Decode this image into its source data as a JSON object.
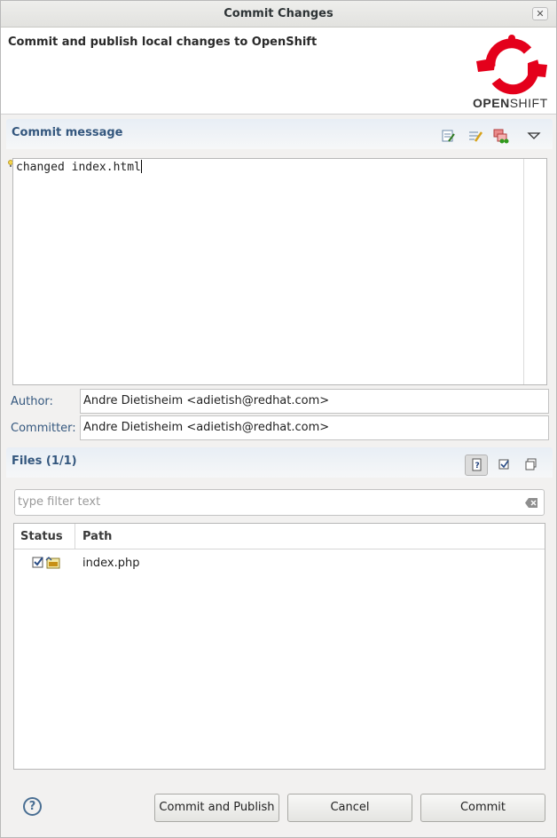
{
  "window": {
    "title": "Commit Changes",
    "close_icon": "close-icon"
  },
  "banner": {
    "description": "Commit and publish local changes to OpenShift",
    "logo_text_bold": "OPEN",
    "logo_text_rest": "SHIFT",
    "logo_color": "#e4001b"
  },
  "commit_section": {
    "title": "Commit message",
    "toolbar_icons": [
      "add-signed-off-by-icon",
      "amend-icon",
      "push-icon",
      "view-menu-chevron-icon"
    ],
    "message": "changed index.html"
  },
  "author": {
    "label": "Author:",
    "value": "Andre Dietisheim <adietish@redhat.com>"
  },
  "committer": {
    "label": "Committer:",
    "value": "Andre Dietisheim <adietish@redhat.com>"
  },
  "files_section": {
    "title": "Files (1/1)",
    "toolbar_icons": [
      "show-untracked-icon",
      "select-all-icon",
      "deselect-all-icon"
    ],
    "filter_placeholder": "type filter text",
    "columns": [
      "Status",
      "Path"
    ],
    "rows": [
      {
        "checked": true,
        "file_icon": "html-file-icon",
        "path": "index.php"
      }
    ]
  },
  "buttons": {
    "help": "?",
    "commit_and_publish": "Commit and Publish",
    "cancel": "Cancel",
    "commit": "Commit"
  },
  "colors": {
    "section_title": "#34577e",
    "accent_red": "#e4001b"
  }
}
